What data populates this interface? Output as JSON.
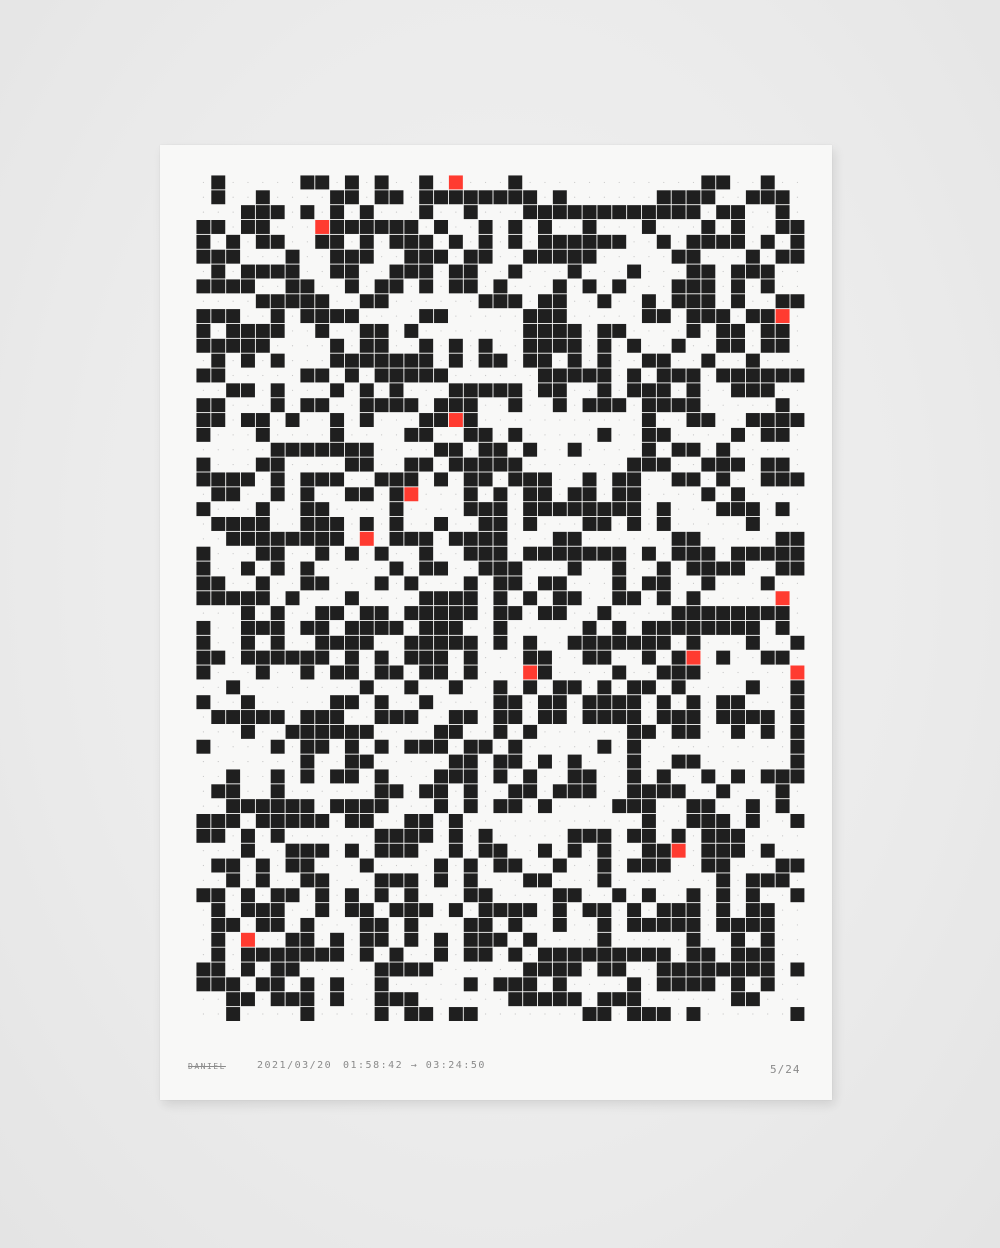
{
  "artwork": {
    "signature": "DANIEL",
    "date": "2021/03/20",
    "time_range": "01:58:42 → 03:24:50",
    "edition": "5/24",
    "colors": {
      "ink": "#1f1f1f",
      "accent": "#ff3b30",
      "paper": "#f8f8f7"
    },
    "grid_columns": 41,
    "grid_rows": 57,
    "red_cells": [
      [
        17,
        0
      ],
      [
        8,
        3
      ],
      [
        39,
        9
      ],
      [
        17,
        16
      ],
      [
        14,
        21
      ],
      [
        11,
        24
      ],
      [
        39,
        28
      ],
      [
        33,
        32
      ],
      [
        40,
        33
      ],
      [
        22,
        33
      ],
      [
        32,
        45
      ],
      [
        3,
        51
      ]
    ]
  }
}
